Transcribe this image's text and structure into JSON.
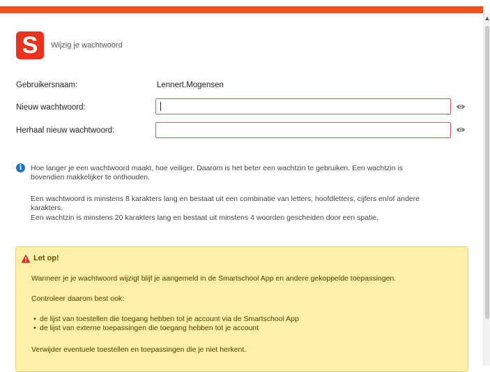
{
  "colors": {
    "accent": "#f4511e",
    "logo": "#e8331d",
    "info": "#1a73c9",
    "warning_bg": "#fdf0a8",
    "warning_icon": "#d9281e",
    "error_border": "#d9534f"
  },
  "header": {
    "logo_letter": "S",
    "title": "Wijzig je wachtwoord"
  },
  "form": {
    "username_label": "Gebruikersnaam:",
    "username_value": "Lennert.Mogensen",
    "new_password_label": "Nieuw wachtwoord:",
    "repeat_password_label": "Herhaal nieuw wachtwoord:",
    "new_password_value": "",
    "repeat_password_value": ""
  },
  "info": {
    "line1": "Hoe langer je een wachtwoord maakt, hoe veiliger. Daarom is het beter een wachtzin te gebruiken. Een wachtzin is",
    "line2": "bovendien makkelijker te onthouden.",
    "line3": "Een wachtwoord is minstens 8 karakters lang en bestaat uit een combinatie van letters, hoofdletters, cijfers en/of andere",
    "line4": "karakters.",
    "line5": "Een wachtzin is minstens 20 karakters lang en bestaat uit minstens 4 woorden gescheiden door een spatie."
  },
  "warning": {
    "title": "Let op!",
    "text1": "Wanneer je je wachtwoord wijzigt blijf je aangemeld in de Smartschool App en andere gekoppelde toepassingen.",
    "text2": "Controleer daarom best ook:",
    "bullets": [
      "de lijst van toestellen die toegang hebben tot je account via de Smartschool App",
      "de lijst van externe toepassingen die toegang hebben tot je account"
    ],
    "text3": "Verwijder eventuele toestellen en toepassingen die je niet herkent."
  }
}
